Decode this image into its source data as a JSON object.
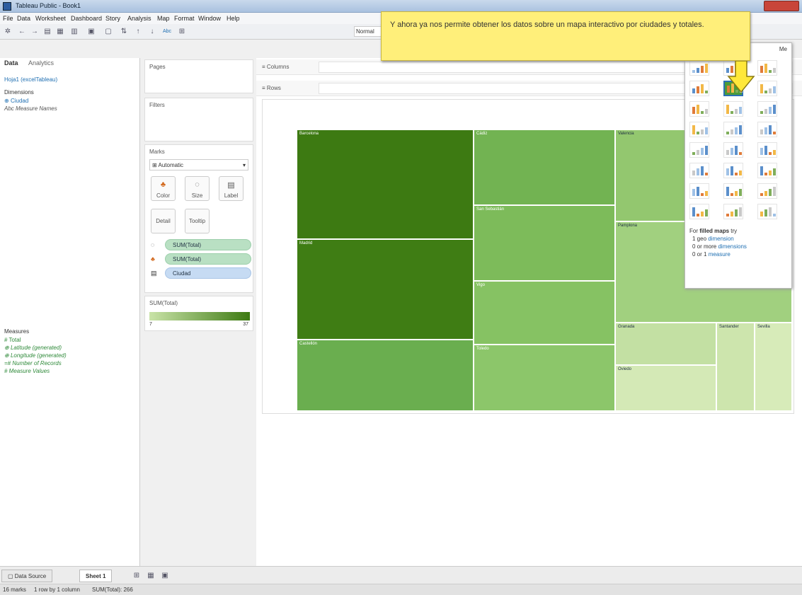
{
  "window": {
    "title": "Tableau Public - Book1"
  },
  "menu": [
    "File",
    "Data",
    "Worksheet",
    "Dashboard",
    "Story",
    "Analysis",
    "Map",
    "Format",
    "Window",
    "Help"
  ],
  "toolbar": {
    "fit": "Normal",
    "abc": "Abc"
  },
  "left": {
    "tab_data": "Data",
    "tab_analytics": "Analytics",
    "datasource": "Hoja1 (excelTableau)",
    "dimensions_title": "Dimensions",
    "dimensions": [
      "Ciudad",
      "Measure Names"
    ],
    "measures_title": "Measures",
    "measures": [
      "Total",
      "Latitude (generated)",
      "Longitude (generated)",
      "Number of Records",
      "Measure Values"
    ]
  },
  "cards": {
    "pages": "Pages",
    "filters": "Filters",
    "marks": "Marks",
    "mark_type": "Automatic",
    "buttons": {
      "color": "Color",
      "size": "Size",
      "label": "Label",
      "detail": "Detail",
      "tooltip": "Tooltip"
    },
    "pills": [
      "SUM(Total)",
      "SUM(Total)",
      "Ciudad"
    ],
    "legend_title": "SUM(Total)",
    "legend_min": "7",
    "legend_max": "37",
    "legend_colors": [
      "#c9e3a8",
      "#3d7a12"
    ]
  },
  "shelves": {
    "columns": "Columns",
    "rows": "Rows"
  },
  "chart_data": {
    "type": "treemap",
    "measure": "SUM(Total)",
    "cities": [
      "Barcelona",
      "Madrid",
      "Castellón",
      "Cádiz",
      "San Sebastián",
      "Vigo",
      "Toledo",
      "Valencia",
      "Pamplona",
      "Granada",
      "Santander",
      "Sevilla",
      "Oviedo"
    ]
  },
  "showme": {
    "help_prefix": "For ",
    "help_bold": "filled maps",
    "help_suffix": " try",
    "line1_pre": "1 geo ",
    "line1_link": "dimension",
    "line2_pre": "0 or more ",
    "line2_link": "dimensions",
    "line3_pre": "0 or 1 ",
    "line3_link": "measure",
    "header": "Me"
  },
  "callout": {
    "text": "Y ahora ya nos permite obtener los datos sobre un mapa interactivo por ciudades y totales."
  },
  "bottom": {
    "datasource_tab": "Data Source",
    "sheet_tab": "Sheet 1",
    "status_marks": "16 marks",
    "status_rows": "1 row by 1 column",
    "status_sum": "SUM(Total): 266"
  },
  "colors": {
    "accent": "#4e8a1c",
    "callout_bg": "#ffef7a"
  }
}
